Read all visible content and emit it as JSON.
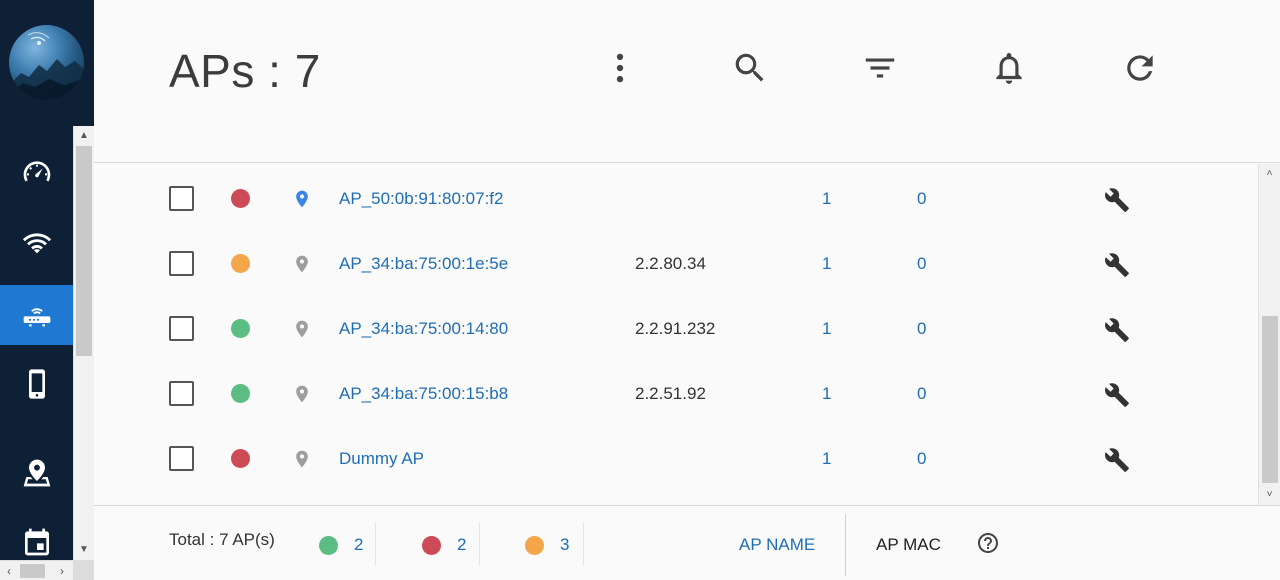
{
  "header": {
    "title": "APs : 7",
    "actions": [
      {
        "name": "more-options",
        "icon": "more-vert-icon"
      },
      {
        "name": "search",
        "icon": "search-icon"
      },
      {
        "name": "filter",
        "icon": "filter-icon"
      },
      {
        "name": "notifications",
        "icon": "bell-icon"
      },
      {
        "name": "refresh",
        "icon": "refresh-icon"
      }
    ]
  },
  "sidebar": {
    "items": [
      {
        "name": "dashboard",
        "icon": "speedometer-icon",
        "active": false
      },
      {
        "name": "wifi",
        "icon": "wifi-icon",
        "active": false
      },
      {
        "name": "access-points",
        "icon": "router-icon",
        "active": true
      },
      {
        "name": "clients",
        "icon": "phone-icon",
        "active": false
      },
      {
        "name": "map",
        "icon": "map-pin-icon",
        "active": false
      },
      {
        "name": "events",
        "icon": "calendar-icon",
        "active": false
      }
    ]
  },
  "colors": {
    "red": "#cc4b57",
    "orange": "#f4a64b",
    "green": "#5cbd84",
    "pin_blue": "#3b86e8",
    "pin_gray": "#9e9e9e",
    "link": "#1f6db4",
    "active_nav": "#1f78d1"
  },
  "rows": [
    {
      "status": "red",
      "pin": "blue",
      "name": "AP_50:0b:91:80:07:f2",
      "ip": "",
      "count1": "1",
      "count2": "0"
    },
    {
      "status": "orange",
      "pin": "gray",
      "name": "AP_34:ba:75:00:1e:5e",
      "ip": "2.2.80.34",
      "count1": "1",
      "count2": "0"
    },
    {
      "status": "green",
      "pin": "gray",
      "name": "AP_34:ba:75:00:14:80",
      "ip": "2.2.91.232",
      "count1": "1",
      "count2": "0"
    },
    {
      "status": "green",
      "pin": "gray",
      "name": "AP_34:ba:75:00:15:b8",
      "ip": "2.2.51.92",
      "count1": "1",
      "count2": "0"
    },
    {
      "status": "red",
      "pin": "gray",
      "name": "Dummy AP",
      "ip": "",
      "count1": "1",
      "count2": "0"
    }
  ],
  "footer": {
    "total": "Total : 7 AP(s)",
    "stats": [
      {
        "status": "green",
        "count": "2"
      },
      {
        "status": "red",
        "count": "2"
      },
      {
        "status": "orange",
        "count": "3"
      }
    ],
    "ap_name_label": "AP NAME",
    "ap_mac_label": "AP MAC",
    "help_icon": "help-circle-icon"
  }
}
